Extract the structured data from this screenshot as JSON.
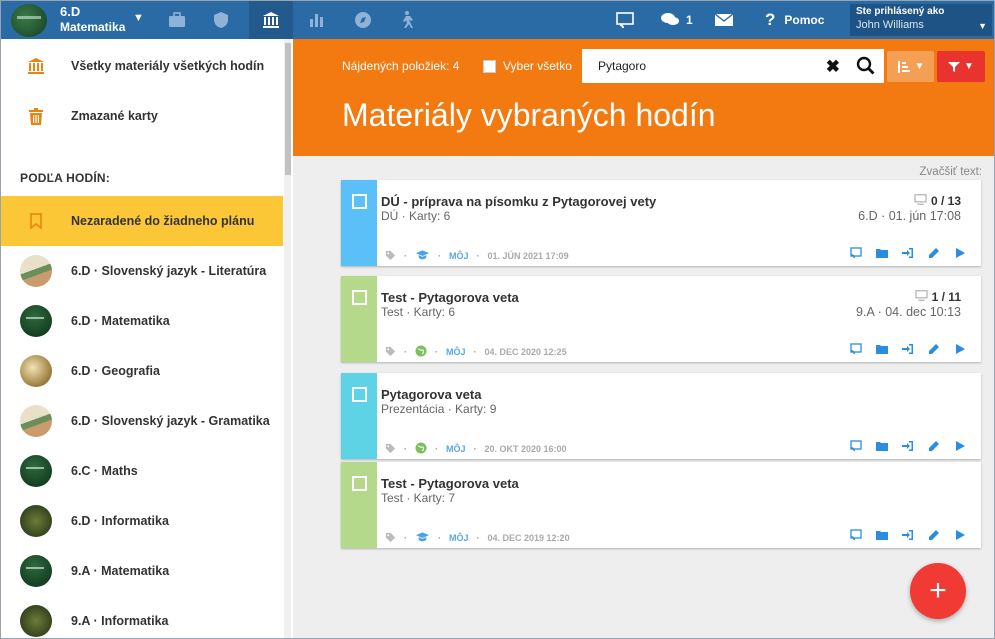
{
  "topbar": {
    "class_name": "6.D",
    "subject": "Matematika",
    "notifications_count": "1",
    "help_label": "Pomoc",
    "login_label": "Ste prihlásený ako",
    "user_name": "John Williams"
  },
  "sidebar": {
    "all_materials": "Všetky materiály všetkých hodín",
    "deleted_cards": "Zmazané karty",
    "section_title": "PODĽA HODÍN:",
    "unassigned": "Nezaradené do žiadneho plánu",
    "lessons": [
      {
        "label": "6.D · Slovenský jazyk - Literatúra",
        "thumb": "book"
      },
      {
        "label": "6.D · Matematika",
        "thumb": "chalk"
      },
      {
        "label": "6.D · Geografia",
        "thumb": "geo"
      },
      {
        "label": "6.D · Slovenský jazyk - Gramatika",
        "thumb": "book"
      },
      {
        "label": "6.C · Maths",
        "thumb": "chalk"
      },
      {
        "label": "6.D · Informatika",
        "thumb": "dark"
      },
      {
        "label": "9.A · Matematika",
        "thumb": "chalk"
      },
      {
        "label": "9.A · Informatika",
        "thumb": "dark"
      }
    ]
  },
  "main": {
    "found_label": "Nájdených položiek: 4",
    "select_all": "Vyber všetko",
    "search_value": "Pytagoro",
    "title": "Materiály vybraných hodín",
    "zoom_text": "Zvačšiť text:",
    "cards": [
      {
        "title": "DÚ - príprava na písomku z Pytagorovej vety",
        "subtitle": "DÚ · Karty: 6",
        "count": "0 / 13",
        "class_date": "6.D · 01. jún 17:08",
        "owner": "MÔJ",
        "date": "01. JÚN 2021 17:09",
        "color": "#5bc0f8",
        "badge": "graduation-cap-icon"
      },
      {
        "title": "Test - Pytagorova veta",
        "subtitle": "Test · Karty: 6",
        "count": "1 / 11",
        "class_date": "9.A · 04. dec 10:13",
        "owner": "MÔJ",
        "date": "04. DEC 2020 12:25",
        "color": "#b4d98b",
        "badge": "globe-icon"
      },
      {
        "title": "Pytagorova veta",
        "subtitle": "Prezentácia · Karty: 9",
        "count": "",
        "class_date": "",
        "owner": "MÔJ",
        "date": "20. OKT 2020 16:00",
        "color": "#5fd3e6",
        "badge": "globe-icon"
      },
      {
        "title": "Test - Pytagorova veta",
        "subtitle": "Test · Karty: 7",
        "count": "",
        "class_date": "",
        "owner": "MÔJ",
        "date": "04. DEC 2019 12:20",
        "color": "#b4d98b",
        "badge": "graduation-cap-icon"
      }
    ]
  }
}
